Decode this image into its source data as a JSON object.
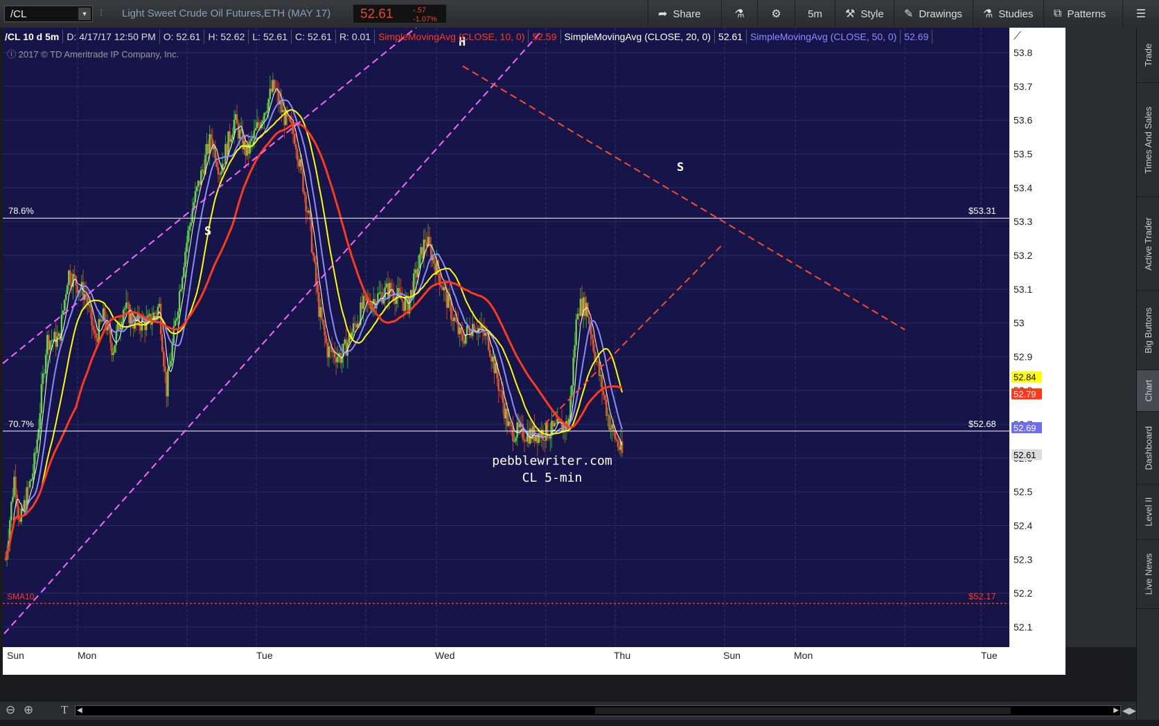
{
  "toolbar": {
    "symbol": "/CL",
    "description": "Light Sweet Crude Oil Futures,ETH (MAY 17)",
    "last": "52.61",
    "change": "-.57",
    "change_pct": "-1.07%",
    "buttons": [
      {
        "label": "Share",
        "icon": "share-icon"
      },
      {
        "label": "",
        "icon": "flask-icon"
      },
      {
        "label": "",
        "icon": "gear-icon"
      },
      {
        "label": "5m",
        "icon": ""
      },
      {
        "label": "Style",
        "icon": "style-icon"
      },
      {
        "label": "Drawings",
        "icon": "pencil-icon"
      },
      {
        "label": "Studies",
        "icon": "flask-icon"
      },
      {
        "label": "Patterns",
        "icon": "patterns-icon"
      }
    ]
  },
  "legend": {
    "title": "/CL 10 d 5m",
    "date": "D: 4/17/17 12:50 PM",
    "open": "O: 52.61",
    "high": "H: 52.62",
    "low": "L: 52.61",
    "close": "C: 52.61",
    "range": "R: 0.01",
    "sma10_label": "SimpleMovingAvg (CLOSE, 10, 0)",
    "sma10_value": "52.59",
    "sma20_label": "SimpleMovingAvg (CLOSE, 20, 0)",
    "sma20_value": "52.61",
    "sma50_label": "SimpleMovingAvg (CLOSE, 50, 0)",
    "sma50_value": "52.69"
  },
  "copyright": "2017 © TD Ameritrade IP Company, Inc.",
  "annotations": {
    "left_shoulder": "S",
    "head": "H",
    "right_shoulder": "S",
    "watermark_line1": "pebblewriter.com",
    "watermark_line2": "CL 5-min",
    "fib_786": "78.6%",
    "fib_707": "70.7%",
    "fib_786_price": "$53.31",
    "fib_707_price": "$52.68",
    "sma_tag": "SMA10",
    "sma_price": "$52.17"
  },
  "price_tags": [
    {
      "value": "52.84",
      "color": "#ffff00",
      "text": "#000000"
    },
    {
      "value": "52.79",
      "color": "#ff3a1a",
      "text": "#ffffff"
    },
    {
      "value": "52.69",
      "color": "#6e6cf0",
      "text": "#ffffff"
    },
    {
      "value": "52.61",
      "color": "#dddddd",
      "text": "#000000"
    }
  ],
  "side_tabs": [
    "Trade",
    "Times And Sales",
    "Active Trader",
    "Big Buttons",
    "Chart",
    "Dashboard",
    "Level II",
    "Live News"
  ],
  "colors": {
    "background": "#16154a",
    "sma10": "#ffffff",
    "sma20": "#8c8cff",
    "sma50": "#ffff00",
    "sma100": "#ff3a1a",
    "trend_up": "#ff66ff",
    "trend_down": "#ff4a2a"
  },
  "chart_data": {
    "type": "candlestick",
    "y_ticks": [
      "53.8",
      "53.7",
      "53.6",
      "53.5",
      "53.4",
      "53.3",
      "53.2",
      "53.1",
      "53",
      "52.9",
      "52.8",
      "52.7",
      "52.6",
      "52.5",
      "52.4",
      "52.3",
      "52.2",
      "52.1"
    ],
    "ylim": [
      52.02,
      53.87
    ],
    "x_labels": [
      "Sun",
      "Mon",
      "Tue",
      "Wed",
      "Thu",
      "Sun",
      "Mon",
      "Tue"
    ],
    "price_path": [
      [
        0.0,
        52.3
      ],
      [
        0.05,
        52.55
      ],
      [
        0.08,
        52.4
      ],
      [
        0.1,
        52.45
      ],
      [
        0.15,
        52.55
      ],
      [
        0.17,
        52.62
      ],
      [
        0.23,
        52.95
      ],
      [
        0.3,
        52.95
      ],
      [
        0.35,
        53.15
      ],
      [
        0.45,
        53.08
      ],
      [
        0.5,
        52.95
      ],
      [
        0.55,
        53.02
      ],
      [
        0.6,
        52.92
      ],
      [
        0.66,
        53.05
      ],
      [
        0.72,
        53.0
      ],
      [
        0.8,
        53.0
      ],
      [
        0.86,
        53.05
      ],
      [
        0.9,
        52.8
      ],
      [
        1.0,
        53.2
      ],
      [
        1.05,
        53.35
      ],
      [
        1.15,
        53.55
      ],
      [
        1.2,
        53.45
      ],
      [
        1.28,
        53.6
      ],
      [
        1.35,
        53.5
      ],
      [
        1.5,
        53.7
      ],
      [
        1.55,
        53.62
      ],
      [
        1.62,
        53.55
      ],
      [
        1.7,
        53.3
      ],
      [
        1.75,
        53.05
      ],
      [
        1.8,
        52.92
      ],
      [
        1.88,
        52.9
      ],
      [
        2.0,
        53.05
      ],
      [
        2.15,
        53.1
      ],
      [
        2.25,
        53.05
      ],
      [
        2.35,
        53.25
      ],
      [
        2.42,
        53.15
      ],
      [
        2.48,
        53.05
      ],
      [
        2.55,
        52.95
      ],
      [
        2.62,
        53.0
      ],
      [
        2.7,
        52.95
      ],
      [
        2.82,
        52.68
      ],
      [
        2.95,
        52.67
      ],
      [
        3.05,
        52.68
      ],
      [
        3.15,
        52.7
      ],
      [
        3.2,
        53.05
      ],
      [
        3.25,
        53.05
      ],
      [
        3.3,
        52.9
      ],
      [
        3.38,
        52.7
      ],
      [
        3.45,
        52.61
      ]
    ],
    "series": [
      {
        "name": "SimpleMovingAvg (CLOSE, 10, 0)",
        "last": 52.59
      },
      {
        "name": "SimpleMovingAvg (CLOSE, 20, 0)",
        "last": 52.61
      },
      {
        "name": "SimpleMovingAvg (CLOSE, 50, 0)",
        "last": 52.69
      }
    ],
    "horizontal_lines": [
      {
        "label": "78.6%",
        "value": 53.31
      },
      {
        "label": "70.7%",
        "value": 52.68
      },
      {
        "label": "SMA10",
        "value": 52.17
      }
    ]
  }
}
